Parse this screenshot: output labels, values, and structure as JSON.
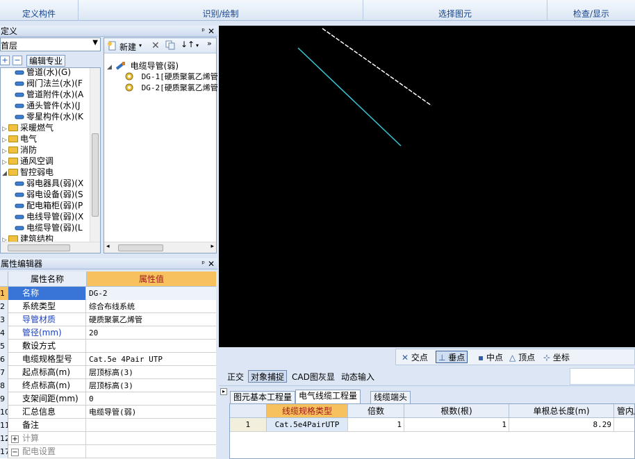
{
  "ribbon": {
    "groups": [
      "定义构件",
      "识别/绘制",
      "选择图元",
      "检查/显示"
    ]
  },
  "definition_panel": {
    "title": "定义",
    "floor_select": "首层",
    "edit_specialty_label": "编辑专业",
    "tree": [
      {
        "label": "管道(水)(G)",
        "level": 2
      },
      {
        "label": "阀门法兰(水)(F",
        "level": 2
      },
      {
        "label": "管道附件(水)(A",
        "level": 2
      },
      {
        "label": "通头管件(水)(J",
        "level": 2
      },
      {
        "label": "零星构件(水)(K",
        "level": 2
      },
      {
        "label": "采暖燃气",
        "level": 1
      },
      {
        "label": "电气",
        "level": 1
      },
      {
        "label": "消防",
        "level": 1
      },
      {
        "label": "通风空调",
        "level": 1
      },
      {
        "label": "智控弱电",
        "level": 1
      },
      {
        "label": "弱电器具(弱)(X",
        "level": 2
      },
      {
        "label": "弱电设备(弱)(S",
        "level": 2
      },
      {
        "label": "配电箱柜(弱)(P",
        "level": 2
      },
      {
        "label": "电线导管(弱)(X",
        "level": 2
      },
      {
        "label": "电缆导管(弱)(L",
        "level": 2
      },
      {
        "label": "建筑结构",
        "level": 1
      }
    ]
  },
  "component_panel": {
    "new_label": "新建",
    "root": "电缆导管(弱)",
    "items": [
      "DG-1[硬质聚氯乙烯管",
      "DG-2[硬质聚氯乙烯管"
    ]
  },
  "property_editor": {
    "title": "属性编辑器",
    "col_name": "属性名称",
    "col_value": "属性值",
    "rows": [
      {
        "num": "1",
        "name": "名称",
        "value": "DG-2",
        "style": "blue",
        "selected": true
      },
      {
        "num": "2",
        "name": "系统类型",
        "value": "综合布线系统",
        "style": ""
      },
      {
        "num": "3",
        "name": "导管材质",
        "value": "硬质聚氯乙烯管",
        "style": "blue"
      },
      {
        "num": "4",
        "name": "管径(mm)",
        "value": "20",
        "style": "blue"
      },
      {
        "num": "5",
        "name": "敷设方式",
        "value": "",
        "style": ""
      },
      {
        "num": "6",
        "name": "电缆规格型号",
        "value": "Cat.5e 4Pair UTP",
        "style": ""
      },
      {
        "num": "7",
        "name": "起点标高(m)",
        "value": "层顶标高(3)",
        "style": ""
      },
      {
        "num": "8",
        "name": "终点标高(m)",
        "value": "层顶标高(3)",
        "style": ""
      },
      {
        "num": "9",
        "name": "支架间距(mm)",
        "value": "0",
        "style": ""
      },
      {
        "num": "10",
        "name": "汇总信息",
        "value": "电缆导管(弱)",
        "style": ""
      },
      {
        "num": "11",
        "name": "备注",
        "value": "",
        "style": ""
      },
      {
        "num": "12",
        "name": "计算",
        "value": "",
        "style": "gray",
        "expand": "+"
      },
      {
        "num": "17",
        "name": "配电设置",
        "value": "",
        "style": "gray",
        "expand": "−"
      }
    ]
  },
  "snap_bar": {
    "items": [
      "交点",
      "垂点",
      "中点",
      "顶点",
      "坐标"
    ]
  },
  "status_bar": {
    "items": [
      "正交",
      "对象捕捉",
      "CAD图灰显",
      "动态输入"
    ]
  },
  "quantity_tabs": [
    "图元基本工程量",
    "电气线缆工程量",
    "线缆端头"
  ],
  "quantity_table": {
    "headers": [
      "线缆规格类型",
      "倍数",
      "根数(根)",
      "单根总长度(m)",
      "管内/"
    ],
    "rows": [
      {
        "num": "1",
        "cells": [
          "Cat.5e4PairUTP",
          "1",
          "1",
          "8.29",
          ""
        ]
      }
    ]
  },
  "colors": {
    "canvas_bg": "#000000",
    "line_cyan": "#38c8d8",
    "line_white": "#ffffff",
    "header_orange": "#f7c25e"
  }
}
